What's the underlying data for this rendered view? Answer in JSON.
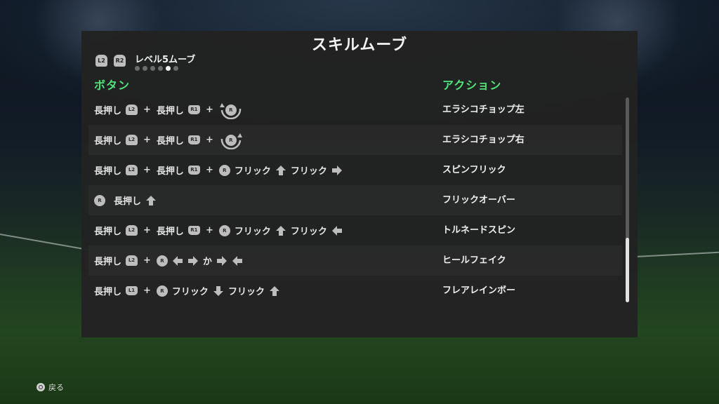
{
  "header": {
    "title": "スキルムーブ",
    "triggers": [
      "L2",
      "R2"
    ],
    "level_label": "レベル5ムーブ",
    "page_dots": {
      "count": 6,
      "active_index": 4
    }
  },
  "columns": {
    "button": "ボタン",
    "action": "アクション"
  },
  "words": {
    "hold": "長押し",
    "flick": "フリック",
    "or": "か"
  },
  "buttons": {
    "L1": "L1",
    "L2": "L2",
    "R1": "R1",
    "R": "R"
  },
  "moves": [
    {
      "action": "エラシコチョップ左"
    },
    {
      "action": "エラシコチョップ右"
    },
    {
      "action": "スピンフリック"
    },
    {
      "action": "フリックオーバー"
    },
    {
      "action": "トルネードスピン"
    },
    {
      "action": "ヒールフェイク"
    },
    {
      "action": "フレアレインボー"
    }
  ],
  "scroll": {
    "position": 0.7
  },
  "footer": {
    "back_label": "戻る"
  },
  "colors": {
    "header_accent": "#4fe37a",
    "panel": "#222222",
    "icon": "#bdbdbd"
  }
}
